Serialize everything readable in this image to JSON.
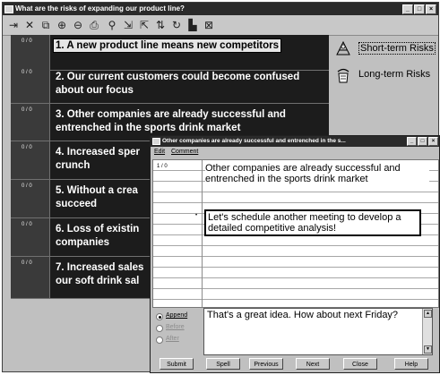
{
  "main_window": {
    "title": "What are the risks of expanding our product line?",
    "title_buttons": [
      "_",
      "□",
      "×"
    ]
  },
  "toolbar": {
    "icons": [
      "add-icon",
      "delete-icon",
      "open-icon",
      "up-icon",
      "down-icon",
      "print-icon",
      "link-icon",
      "import-icon",
      "export-icon",
      "sort-icon",
      "refresh-icon",
      "chart-icon",
      "close-icon"
    ]
  },
  "questions": [
    {
      "count": "0 / 0",
      "text": "1. A new product line means new competitors"
    },
    {
      "count": "0 / 0",
      "text": "2. Our current customers could become confused about our focus"
    },
    {
      "count": "0 / 0",
      "text": "3. Other companies are already successful and entrenched in the sports drink market"
    },
    {
      "count": "0 / 0",
      "text": "4. Increased sper crunch"
    },
    {
      "count": "0 / 0",
      "text": "5. Without a crea succeed"
    },
    {
      "count": "0 / 0",
      "text": "6. Loss of existin companies"
    },
    {
      "count": "0 / 0",
      "text": "7. Increased sales our soft drink sal"
    }
  ],
  "legend": [
    {
      "label": "Short-term Risks",
      "icon": "short-term-risk-icon"
    },
    {
      "label": "Long-term Risks",
      "icon": "long-term-risk-icon"
    }
  ],
  "popup": {
    "title": "Other companies are already successful and entrenched in the s...",
    "menu": [
      "Edit",
      "Comment"
    ],
    "count": "1 / 0",
    "note_text": "Other companies are already successful and entrenched in the sports drink market",
    "comment_bullet": "•",
    "comment_text": "Let's schedule another meeting to develop a detailed competitive analysis!",
    "options": [
      {
        "label": "Append",
        "selected": true,
        "enabled": true
      },
      {
        "label": "Before",
        "selected": false,
        "enabled": false
      },
      {
        "label": "After",
        "selected": false,
        "enabled": false
      }
    ],
    "reply_text": "That's a great idea. How about next Friday?",
    "buttons": [
      "Submit",
      "Spell",
      "Previous",
      "Next",
      "Close",
      "Help"
    ]
  }
}
